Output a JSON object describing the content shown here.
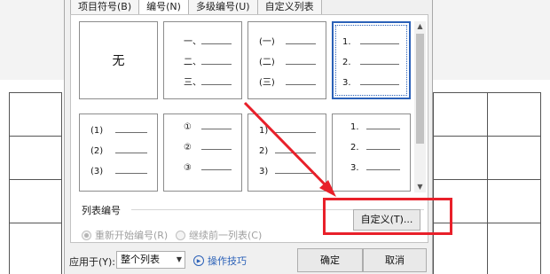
{
  "tabs": [
    {
      "label": "项目符号(B)",
      "active": false
    },
    {
      "label": "编号(N)",
      "active": true
    },
    {
      "label": "多级编号(U)",
      "active": false
    },
    {
      "label": "自定义列表",
      "active": false
    }
  ],
  "gallery": {
    "none_label": "无",
    "cells": [
      {
        "markers": []
      },
      {
        "markers": [
          "一、",
          "二、",
          "三、"
        ]
      },
      {
        "markers": [
          "(一)",
          "(二)",
          "(三)"
        ]
      },
      {
        "markers": [
          "1.",
          "2.",
          "3."
        ],
        "selected": true
      },
      {
        "markers": [
          "(1)",
          "(2)",
          "(3)"
        ]
      },
      {
        "markers": [
          "①",
          "②",
          "③"
        ]
      },
      {
        "markers": [
          "1)",
          "2)",
          "3)"
        ]
      },
      {
        "markers": [
          "1.",
          "2.",
          "3."
        ]
      }
    ]
  },
  "scrollbar": {
    "up_icon": "▲",
    "down_icon": "▼"
  },
  "list_numbering": {
    "title": "列表编号",
    "restart_label": "重新开始编号(R)",
    "continue_label": "继续前一列表(C)"
  },
  "custom_button": "自定义(T)...",
  "footer": {
    "apply_label": "应用于(Y):",
    "apply_value": "整个列表",
    "tips_label": "操作技巧",
    "ok": "确定",
    "cancel": "取消"
  },
  "colors": {
    "annotation": "#e8202a",
    "selection": "#2b61b8"
  }
}
